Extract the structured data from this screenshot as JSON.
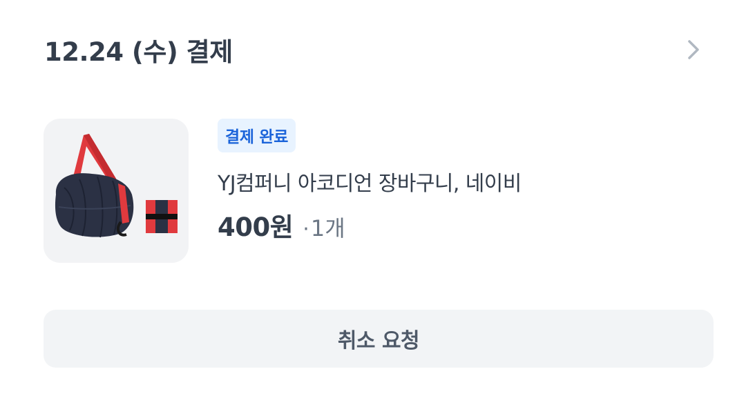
{
  "order": {
    "date_label": "12.24 (수) 결제",
    "status": "결제 완료",
    "product_name": "YJ컴퍼니 아코디언 장바구니, 네이비",
    "price": "400원",
    "qty_separator": "·",
    "quantity": "1개",
    "cancel_label": "취소 요청"
  },
  "icons": {
    "detail_chevron": "chevron-right-icon",
    "product_image": "shopping-bag-image"
  },
  "colors": {
    "badge_background": "#e8f3ff",
    "badge_text": "#1b64da",
    "primary_text": "#333d4b",
    "secondary_text": "#6b7684",
    "button_background": "#f2f4f6",
    "thumbnail_background": "#f2f3f5"
  }
}
